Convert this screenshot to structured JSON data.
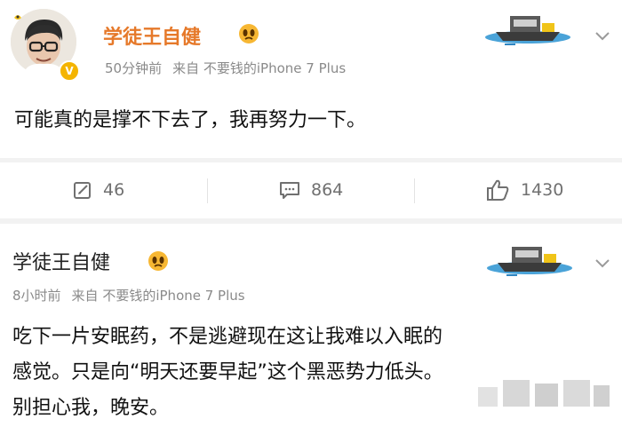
{
  "post1": {
    "author": "学徒王自健",
    "time": "50分钟前",
    "source_prefix": "来自",
    "source": "不要钱的iPhone 7 Plus",
    "text": "可能真的是撑不下去了，我再努力一下。",
    "actions": {
      "repost_count": "46",
      "comment_count": "864",
      "like_count": "1430"
    }
  },
  "post2": {
    "author": "学徒王自健",
    "time": "8小时前",
    "source_prefix": "来自",
    "source": "不要钱的iPhone 7 Plus",
    "text_lines": [
      "吃下一片安眠药，不是逃避现在这让我难以入眠的",
      "感觉。只是向“明天还要早起”这个黑恶势力低头。",
      "别担心我，晚安。"
    ]
  },
  "colors": {
    "username_accent": "#e6792a",
    "meta_gray": "#8a8a8a",
    "action_gray": "#707070"
  },
  "icons": [
    "avatar",
    "verified-badge-icon",
    "emoji-icon",
    "boat-sticker-icon",
    "chevron-down-icon",
    "repost-icon",
    "comment-icon",
    "like-icon"
  ]
}
